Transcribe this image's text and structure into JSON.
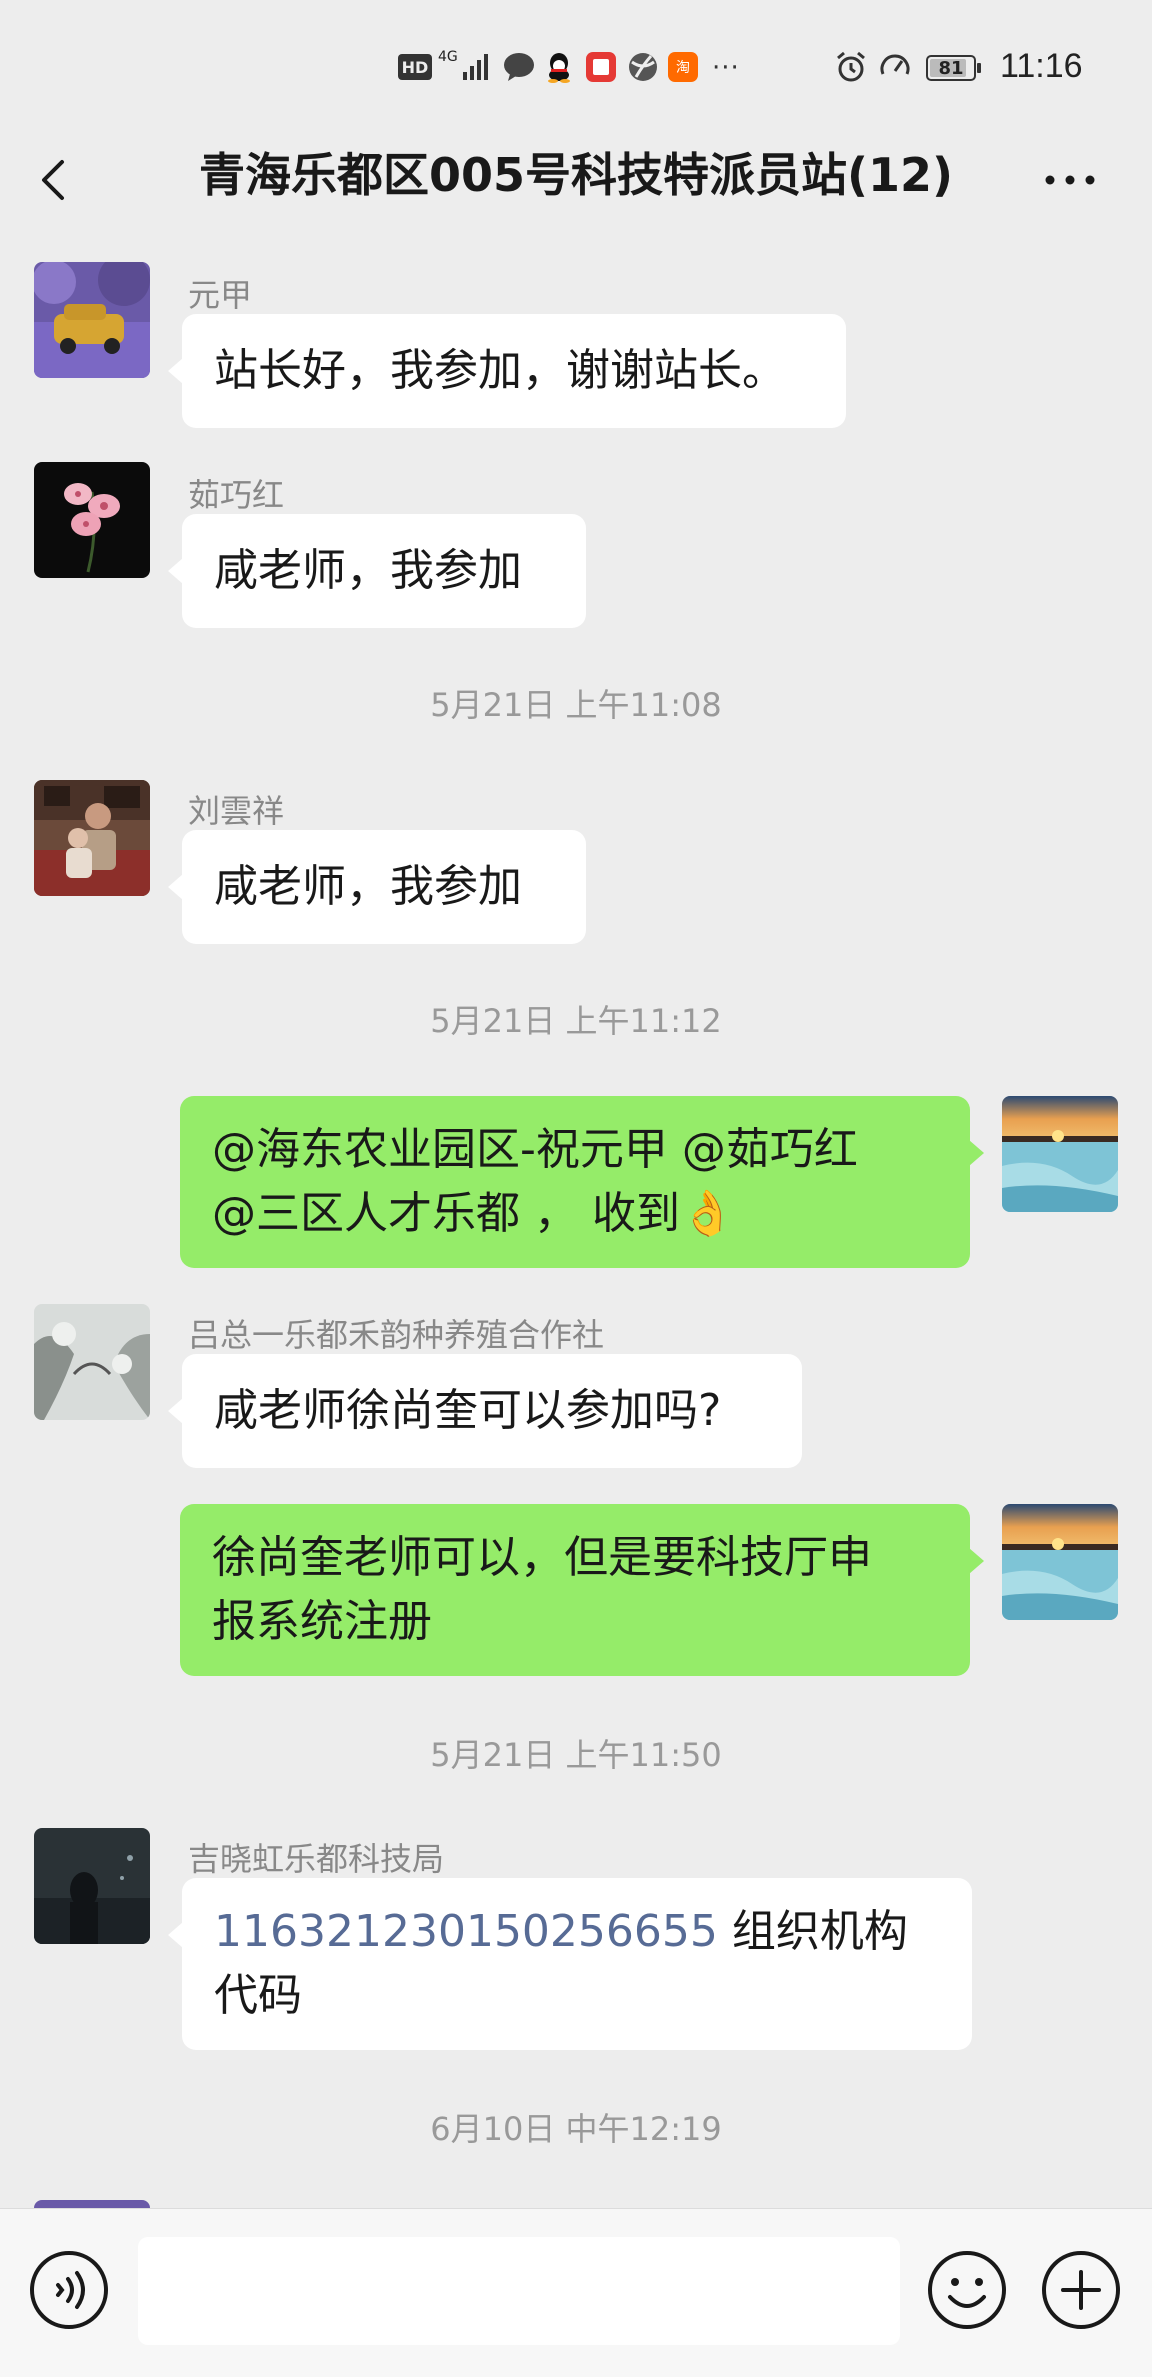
{
  "status_bar": {
    "hd": "HD",
    "network": "4G",
    "battery": "81",
    "time": "11:16",
    "overflow": "···"
  },
  "title_bar": {
    "title": "青海乐都区005号科技特派员站(12)",
    "back_icon": "chevron-left-icon",
    "more_icon": "more-dots-icon"
  },
  "messages": [
    {
      "type": "in",
      "sender": "元甲",
      "text": "站长好，我参加，谢谢站长。"
    },
    {
      "type": "in",
      "sender": "茹巧红",
      "text": "咸老师，我参加"
    },
    {
      "type": "time",
      "text": "5月21日 上午11:08"
    },
    {
      "type": "in",
      "sender": "刘雲祥",
      "text": "咸老师，我参加"
    },
    {
      "type": "time",
      "text": "5月21日 上午11:12"
    },
    {
      "type": "out",
      "line1": "@海东农业园区-祝元甲 @茹巧红",
      "line2": "@三区人才乐都 ， 收到",
      "emoji": "👌"
    },
    {
      "type": "in",
      "sender": "吕总一乐都禾韵种养殖合作社",
      "text": "咸老师徐尚奎可以参加吗?"
    },
    {
      "type": "out",
      "line1": "徐尚奎老师可以，但是要科技厅申",
      "line2": "报系统注册"
    },
    {
      "type": "time",
      "text": "5月21日 上午11:50"
    },
    {
      "type": "in",
      "sender": "吉晓虹乐都科技局",
      "number": "116321230150256655",
      "line1_rest": " 组织机构",
      "line2": "代码"
    },
    {
      "type": "time",
      "text": "6月10日 中午12:19"
    }
  ],
  "input_bar": {
    "voice_icon": "voice-icon",
    "input_value": "",
    "emoji_icon": "emoji-icon",
    "plus_icon": "plus-icon"
  },
  "colors": {
    "background": "#ededed",
    "incoming_bubble": "#ffffff",
    "outgoing_bubble": "#95ec69",
    "link": "#576b95"
  }
}
